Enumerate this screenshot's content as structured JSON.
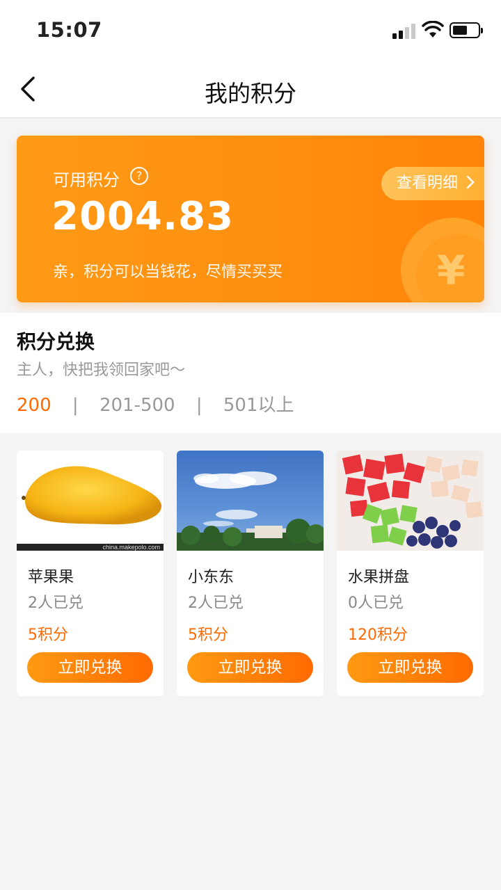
{
  "status": {
    "time": "15:07"
  },
  "nav": {
    "title": "我的积分"
  },
  "points_card": {
    "label": "可用积分",
    "help_glyph": "?",
    "amount": "2004.83",
    "tip": "亲，积分可以当钱花，尽情买买买",
    "detail_button": "查看明细",
    "coin_symbol": "¥"
  },
  "exchange": {
    "title": "积分兑换",
    "subtitle": "主人，快把我领回家吧～",
    "filters": [
      "200",
      "201-500",
      "501以上"
    ],
    "active_filter": 0,
    "separator": "|"
  },
  "products": [
    {
      "name": "苹果果",
      "redeemed": "2人已兑",
      "points": "5积分",
      "button": "立即兑换",
      "image": "mango",
      "watermark": "china.makepolo.com"
    },
    {
      "name": "小东东",
      "redeemed": "2人已兑",
      "points": "5积分",
      "button": "立即兑换",
      "image": "sky"
    },
    {
      "name": "水果拼盘",
      "redeemed": "0人已兑",
      "points": "120积分",
      "button": "立即兑换",
      "image": "fruit-platter"
    }
  ],
  "colors": {
    "accent": "#ff6a00",
    "card_orange": "#ff8f0f"
  }
}
